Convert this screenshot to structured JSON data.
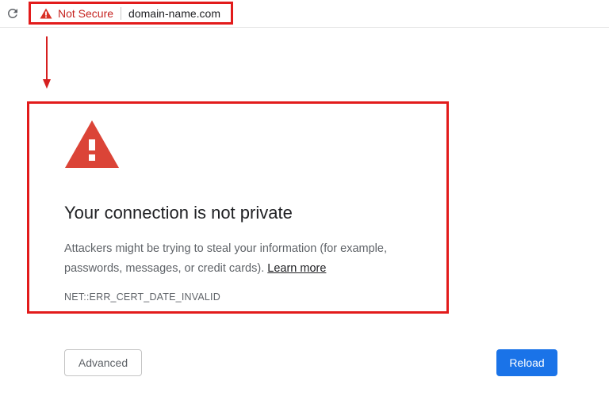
{
  "browser": {
    "security_label": "Not Secure",
    "url": "domain-name.com",
    "icons": {
      "reload": "reload-icon",
      "security": "warning-triangle-icon"
    }
  },
  "error": {
    "icon": "warning-triangle-icon",
    "headline": "Your connection is not private",
    "description": "Attackers might be trying to steal your information  (for example, passwords, messages, or credit cards).",
    "learn_more": "Learn more",
    "code": "NET::ERR_CERT_DATE_INVALID"
  },
  "actions": {
    "advanced": "Advanced",
    "reload": "Reload"
  },
  "colors": {
    "highlight": "#e21b1b",
    "warning": "#d93025",
    "not_secure_text": "#c5221f",
    "primary_button": "#1a73e8"
  }
}
